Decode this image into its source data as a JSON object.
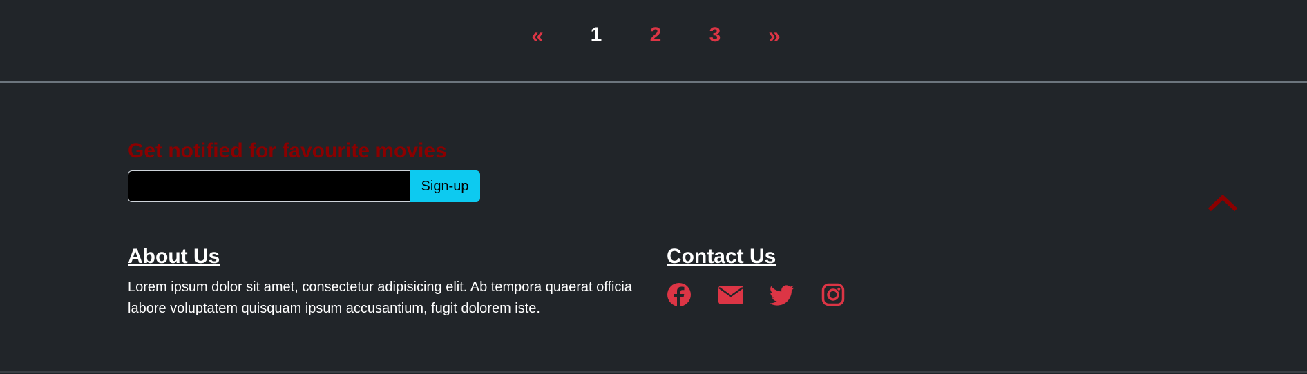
{
  "pagination": {
    "prev": "«",
    "pages": [
      "1",
      "2",
      "3"
    ],
    "active_page": "1",
    "next": "»"
  },
  "newsletter": {
    "title": "Get notified for favourite movies",
    "email_value": "",
    "signup_label": "Sign-up"
  },
  "about": {
    "heading": "About Us",
    "text": "Lorem ipsum dolor sit amet, consectetur adipisicing elit. Ab tempora quaerat officia labore voluptatem quisquam ipsum accusantium, fugit dolorem iste."
  },
  "contact": {
    "heading": "Contact Us",
    "icons": [
      "facebook-icon",
      "envelope-icon",
      "twitter-icon",
      "instagram-icon"
    ]
  },
  "colors": {
    "background": "#212529",
    "accent": "#dc3545",
    "title_red": "#8b0000",
    "button": "#0dcaf0"
  }
}
